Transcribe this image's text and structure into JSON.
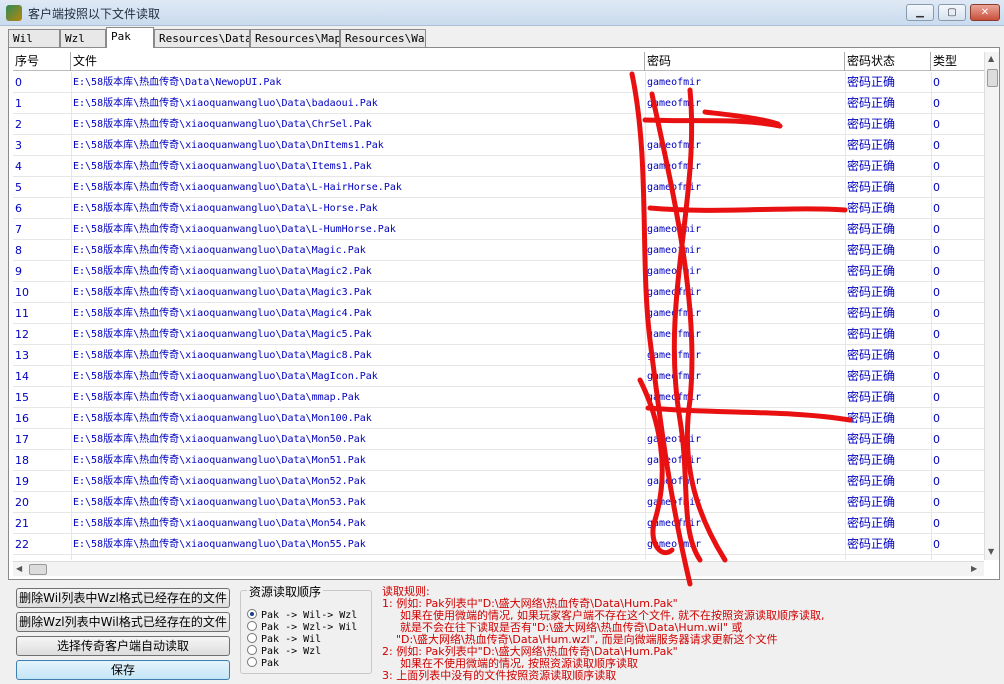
{
  "window": {
    "title": "客户端按照以下文件读取"
  },
  "tabs": [
    "Wil",
    "Wzl",
    "Pak",
    "Resources\\Data",
    "Resources\\Map",
    "Resources\\Wav"
  ],
  "active_tab": "Pak",
  "table": {
    "columns": [
      "序号",
      "文件",
      "密码",
      "密码状态",
      "类型"
    ],
    "rows": [
      {
        "idx": "0",
        "file": "E:\\58版本库\\热血传奇\\Data\\NewopUI.Pak",
        "pwd": "gameofmir",
        "status": "密码正确",
        "type": "0"
      },
      {
        "idx": "1",
        "file": "E:\\58版本库\\热血传奇\\xiaoquanwangluo\\Data\\badaoui.Pak",
        "pwd": "gameofmir",
        "status": "密码正确",
        "type": "0"
      },
      {
        "idx": "2",
        "file": "E:\\58版本库\\热血传奇\\xiaoquanwangluo\\Data\\ChrSel.Pak",
        "pwd": "",
        "status": "密码正确",
        "type": "0"
      },
      {
        "idx": "3",
        "file": "E:\\58版本库\\热血传奇\\xiaoquanwangluo\\Data\\DnItems1.Pak",
        "pwd": "gameofmir",
        "status": "密码正确",
        "type": "0"
      },
      {
        "idx": "4",
        "file": "E:\\58版本库\\热血传奇\\xiaoquanwangluo\\Data\\Items1.Pak",
        "pwd": "gameofmir",
        "status": "密码正确",
        "type": "0"
      },
      {
        "idx": "5",
        "file": "E:\\58版本库\\热血传奇\\xiaoquanwangluo\\Data\\L-HairHorse.Pak",
        "pwd": "gameofmir",
        "status": "密码正确",
        "type": "0"
      },
      {
        "idx": "6",
        "file": "E:\\58版本库\\热血传奇\\xiaoquanwangluo\\Data\\L-Horse.Pak",
        "pwd": "",
        "status": "密码正确",
        "type": "0"
      },
      {
        "idx": "7",
        "file": "E:\\58版本库\\热血传奇\\xiaoquanwangluo\\Data\\L-HumHorse.Pak",
        "pwd": "gameofmir",
        "status": "密码正确",
        "type": "0"
      },
      {
        "idx": "8",
        "file": "E:\\58版本库\\热血传奇\\xiaoquanwangluo\\Data\\Magic.Pak",
        "pwd": "gameofmir",
        "status": "密码正确",
        "type": "0"
      },
      {
        "idx": "9",
        "file": "E:\\58版本库\\热血传奇\\xiaoquanwangluo\\Data\\Magic2.Pak",
        "pwd": "gameofmir",
        "status": "密码正确",
        "type": "0"
      },
      {
        "idx": "10",
        "file": "E:\\58版本库\\热血传奇\\xiaoquanwangluo\\Data\\Magic3.Pak",
        "pwd": "gameofmir",
        "status": "密码正确",
        "type": "0"
      },
      {
        "idx": "11",
        "file": "E:\\58版本库\\热血传奇\\xiaoquanwangluo\\Data\\Magic4.Pak",
        "pwd": "gameofmir",
        "status": "密码正确",
        "type": "0"
      },
      {
        "idx": "12",
        "file": "E:\\58版本库\\热血传奇\\xiaoquanwangluo\\Data\\Magic5.Pak",
        "pwd": "gameofmir",
        "status": "密码正确",
        "type": "0"
      },
      {
        "idx": "13",
        "file": "E:\\58版本库\\热血传奇\\xiaoquanwangluo\\Data\\Magic8.Pak",
        "pwd": "gameofmir",
        "status": "密码正确",
        "type": "0"
      },
      {
        "idx": "14",
        "file": "E:\\58版本库\\热血传奇\\xiaoquanwangluo\\Data\\MagIcon.Pak",
        "pwd": "gameofmir",
        "status": "密码正确",
        "type": "0"
      },
      {
        "idx": "15",
        "file": "E:\\58版本库\\热血传奇\\xiaoquanwangluo\\Data\\mmap.Pak",
        "pwd": "gameofmir",
        "status": "密码正确",
        "type": "0"
      },
      {
        "idx": "16",
        "file": "E:\\58版本库\\热血传奇\\xiaoquanwangluo\\Data\\Mon100.Pak",
        "pwd": "",
        "status": "密码正确",
        "type": "0"
      },
      {
        "idx": "17",
        "file": "E:\\58版本库\\热血传奇\\xiaoquanwangluo\\Data\\Mon50.Pak",
        "pwd": "gameofmir",
        "status": "密码正确",
        "type": "0"
      },
      {
        "idx": "18",
        "file": "E:\\58版本库\\热血传奇\\xiaoquanwangluo\\Data\\Mon51.Pak",
        "pwd": "gameofmir",
        "status": "密码正确",
        "type": "0"
      },
      {
        "idx": "19",
        "file": "E:\\58版本库\\热血传奇\\xiaoquanwangluo\\Data\\Mon52.Pak",
        "pwd": "gameofmir",
        "status": "密码正确",
        "type": "0"
      },
      {
        "idx": "20",
        "file": "E:\\58版本库\\热血传奇\\xiaoquanwangluo\\Data\\Mon53.Pak",
        "pwd": "gameofmir",
        "status": "密码正确",
        "type": "0"
      },
      {
        "idx": "21",
        "file": "E:\\58版本库\\热血传奇\\xiaoquanwangluo\\Data\\Mon54.Pak",
        "pwd": "gameofmir",
        "status": "密码正确",
        "type": "0"
      },
      {
        "idx": "22",
        "file": "E:\\58版本库\\热血传奇\\xiaoquanwangluo\\Data\\Mon55.Pak",
        "pwd": "gameofmir",
        "status": "密码正确",
        "type": "0"
      }
    ]
  },
  "buttons": {
    "delete_wil": "删除Wil列表中Wzl格式已经存在的文件",
    "delete_wzl": "删除Wzl列表中Wil格式已经存在的文件",
    "auto_read": "选择传奇客户端自动读取",
    "save": "保存"
  },
  "read_order": {
    "title": "资源读取顺序",
    "options": [
      "Pak -> Wil-> Wzl",
      "Pak -> Wzl-> Wil",
      "Pak -> Wil",
      "Pak -> Wzl",
      "Pak"
    ],
    "selected": 0
  },
  "rules": [
    "读取规则:",
    "1: 例如: Pak列表中\"D:\\盛大网络\\热血传奇\\Data\\Hum.Pak\"",
    "如果在使用微端的情况, 如果玩家客户端不存在这个文件, 就不在按照资源读取顺序读取,",
    "就是不会在往下读取是否有\"D:\\盛大网络\\热血传奇\\Data\\Hum.wil\" 或",
    "\"D:\\盛大网络\\热血传奇\\Data\\Hum.wzl\", 而是向微端服务器请求更新这个文件",
    "2: 例如: Pak列表中\"D:\\盛大网络\\热血传奇\\Data\\Hum.Pak\"",
    "如果在不使用微端的情况, 按照资源读取顺序读取",
    "3: 上面列表中没有的文件按照资源读取顺序读取"
  ],
  "colors": {
    "link_text": "#0000c0",
    "rule_text": "#d00000",
    "scribble": "#e81010"
  },
  "icons": {
    "app": "app-icon",
    "minimize": "minimize-icon",
    "maximize": "maximize-icon",
    "close": "close-icon"
  }
}
